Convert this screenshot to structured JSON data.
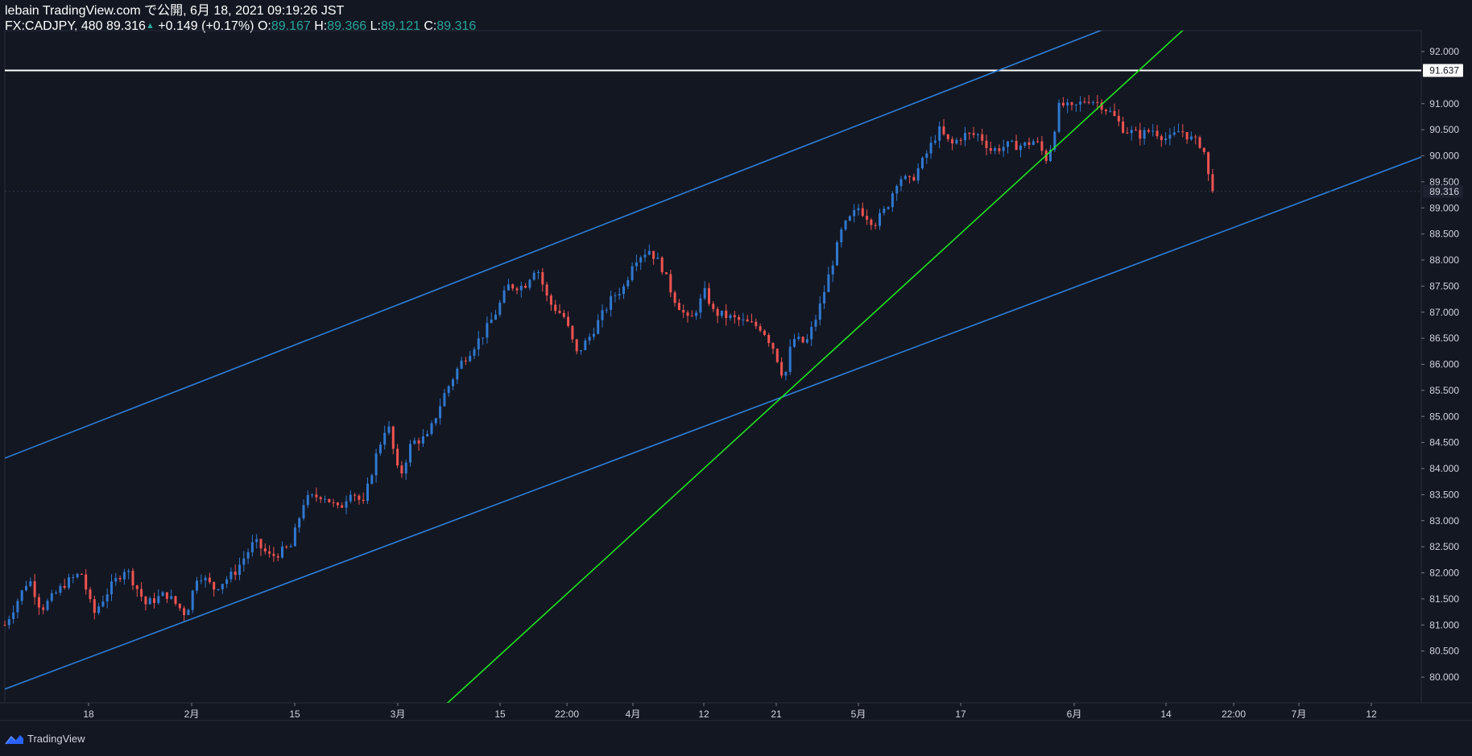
{
  "header": {
    "line1": "lebain TradingView.com で公開, 6月 18, 2021 09:19:26 JST",
    "symbol": "FX:CADJPY, 480",
    "last": "89.316",
    "change": "+0.149 (+0.17%)",
    "o_label": "O:",
    "o_value": "89.167",
    "h_label": "H:",
    "h_value": "89.366",
    "l_label": "L:",
    "l_value": "89.121",
    "c_label": "C:",
    "c_value": "89.316"
  },
  "footer": {
    "brand": "TradingView"
  },
  "colors": {
    "background": "#131722",
    "up": "#2f78d0",
    "down": "#ef5350",
    "channel": "#2e7fd9",
    "trendline": "#1ee61e",
    "resistance": "#ffffff",
    "axis_text": "#d1d4dc"
  },
  "chart_data": {
    "type": "candlestick",
    "symbol": "FX:CADJPY",
    "interval": "480",
    "y_range": [
      79.5,
      92.5
    ],
    "y_ticks": [
      "80.000",
      "80.500",
      "81.000",
      "81.500",
      "82.000",
      "82.500",
      "83.000",
      "83.500",
      "84.000",
      "84.500",
      "85.000",
      "85.500",
      "86.000",
      "86.500",
      "87.000",
      "87.500",
      "88.000",
      "88.500",
      "89.000",
      "89.500",
      "90.000",
      "90.500",
      "91.000",
      "92.000"
    ],
    "x_ticks": [
      "18",
      "2月",
      "15",
      "3月",
      "15",
      "22:00",
      "4月",
      "12",
      "21",
      "5月",
      "17",
      "6月",
      "14",
      "22:00",
      "7月",
      "12"
    ],
    "last_price_label": "89.316",
    "horizontal_level_label": "91.637",
    "horizontal_level": 91.637,
    "lines": [
      {
        "name": "channel-upper",
        "points": [
          [
            0,
            84.2
          ],
          [
            1410,
            92.7
          ]
        ]
      },
      {
        "name": "channel-lower",
        "points": [
          [
            0,
            79.77
          ],
          [
            1763,
            90.0
          ]
        ]
      },
      {
        "name": "green-trendline",
        "points": [
          [
            546,
            79.45
          ],
          [
            1480,
            92.65
          ]
        ]
      }
    ],
    "close_path": [
      [
        0,
        81.0
      ],
      [
        30,
        81.9
      ],
      [
        45,
        81.3
      ],
      [
        75,
        81.8
      ],
      [
        95,
        82.0
      ],
      [
        110,
        81.2
      ],
      [
        130,
        81.7
      ],
      [
        150,
        82.1
      ],
      [
        175,
        81.4
      ],
      [
        200,
        81.6
      ],
      [
        225,
        81.2
      ],
      [
        240,
        82.0
      ],
      [
        260,
        81.7
      ],
      [
        285,
        82.0
      ],
      [
        310,
        82.6
      ],
      [
        330,
        82.3
      ],
      [
        355,
        82.5
      ],
      [
        372,
        83.4
      ],
      [
        395,
        83.5
      ],
      [
        415,
        83.2
      ],
      [
        430,
        83.6
      ],
      [
        445,
        83.3
      ],
      [
        460,
        84.2
      ],
      [
        475,
        84.9
      ],
      [
        490,
        83.8
      ],
      [
        505,
        84.5
      ],
      [
        525,
        84.6
      ],
      [
        545,
        85.4
      ],
      [
        565,
        86.0
      ],
      [
        580,
        86.3
      ],
      [
        595,
        86.6
      ],
      [
        610,
        87.0
      ],
      [
        625,
        87.5
      ],
      [
        645,
        87.5
      ],
      [
        660,
        87.9
      ],
      [
        675,
        87.2
      ],
      [
        695,
        86.9
      ],
      [
        710,
        86.2
      ],
      [
        725,
        86.5
      ],
      [
        740,
        86.9
      ],
      [
        755,
        87.3
      ],
      [
        770,
        87.5
      ],
      [
        780,
        88.0
      ],
      [
        800,
        88.2
      ],
      [
        815,
        87.9
      ],
      [
        830,
        87.3
      ],
      [
        850,
        86.8
      ],
      [
        870,
        87.4
      ],
      [
        880,
        87.0
      ],
      [
        900,
        86.9
      ],
      [
        920,
        86.8
      ],
      [
        940,
        86.7
      ],
      [
        955,
        86.3
      ],
      [
        968,
        85.7
      ],
      [
        978,
        86.5
      ],
      [
        995,
        86.4
      ],
      [
        1010,
        87.0
      ],
      [
        1025,
        87.8
      ],
      [
        1040,
        88.6
      ],
      [
        1060,
        89.0
      ],
      [
        1080,
        88.7
      ],
      [
        1095,
        89.0
      ],
      [
        1110,
        89.6
      ],
      [
        1125,
        89.5
      ],
      [
        1140,
        89.9
      ],
      [
        1160,
        90.5
      ],
      [
        1175,
        90.2
      ],
      [
        1190,
        90.4
      ],
      [
        1210,
        90.4
      ],
      [
        1225,
        90.1
      ],
      [
        1245,
        90.2
      ],
      [
        1265,
        90.2
      ],
      [
        1280,
        90.3
      ],
      [
        1295,
        89.9
      ],
      [
        1310,
        91.0
      ],
      [
        1325,
        90.9
      ],
      [
        1345,
        91.1
      ],
      [
        1360,
        91.0
      ],
      [
        1375,
        90.8
      ],
      [
        1390,
        90.5
      ],
      [
        1410,
        90.4
      ],
      [
        1425,
        90.5
      ],
      [
        1445,
        90.3
      ],
      [
        1460,
        90.5
      ],
      [
        1475,
        90.3
      ],
      [
        1488,
        90.2
      ],
      [
        1493,
        89.7
      ],
      [
        1500,
        89.316
      ]
    ]
  }
}
